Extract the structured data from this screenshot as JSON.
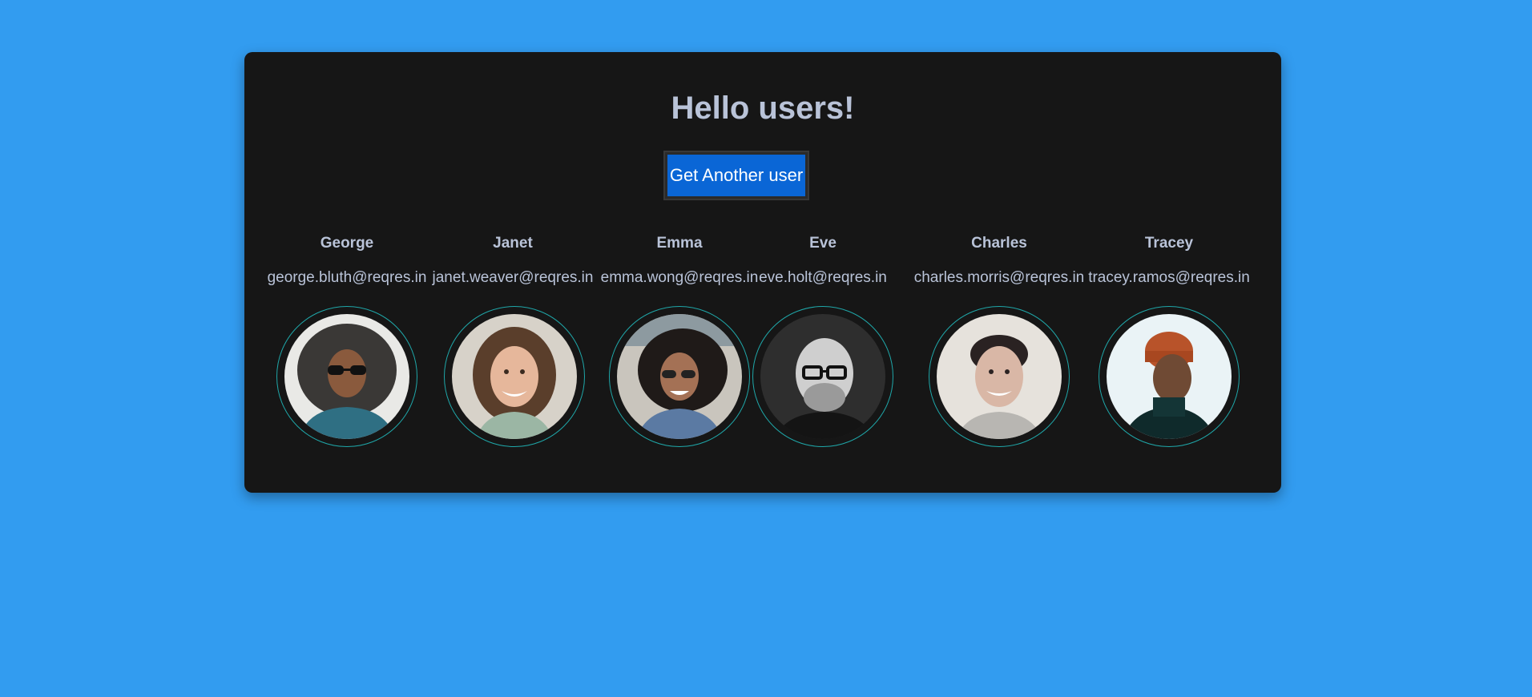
{
  "page": {
    "title": "Hello users!",
    "button_label": "Get Another user"
  },
  "users": [
    {
      "name": "George",
      "email": "george.bluth@reqres.in",
      "avatar": "avatar-photo"
    },
    {
      "name": "Janet",
      "email": "janet.weaver@reqres.in",
      "avatar": "avatar-photo"
    },
    {
      "name": "Emma",
      "email": "emma.wong@reqres.in",
      "avatar": "avatar-photo"
    },
    {
      "name": "Eve",
      "email": "eve.holt@reqres.in",
      "avatar": "avatar-photo"
    },
    {
      "name": "Charles",
      "email": "charles.morris@reqres.in",
      "avatar": "avatar-photo"
    },
    {
      "name": "Tracey",
      "email": "tracey.ramos@reqres.in",
      "avatar": "avatar-photo"
    }
  ],
  "colors": {
    "background": "#329cf0",
    "card": "#161616",
    "text": "#b9c3d8",
    "button": "#0a66d6",
    "ring": "#1fa7a9"
  }
}
